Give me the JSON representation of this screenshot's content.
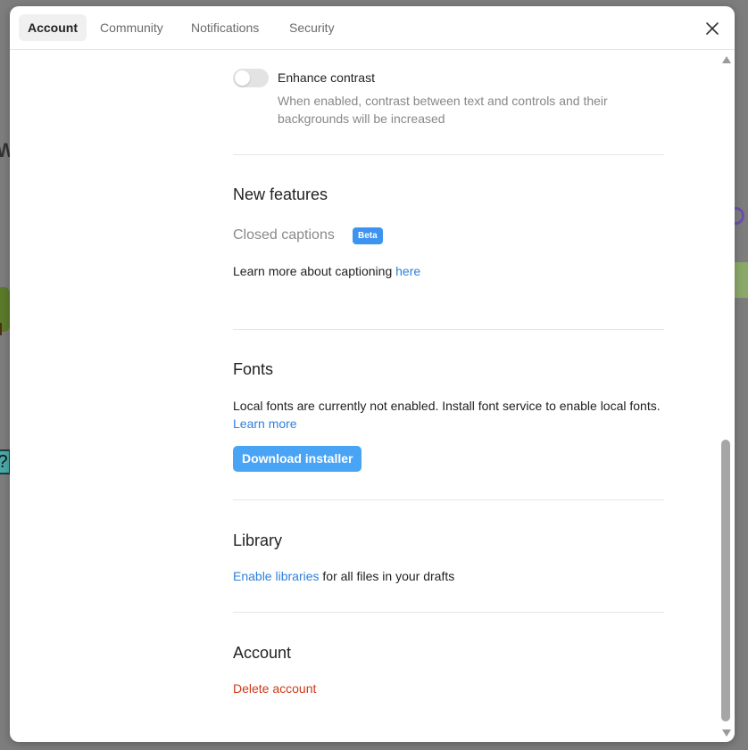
{
  "tabs": [
    {
      "label": "Account",
      "active": true
    },
    {
      "label": "Community",
      "active": false
    },
    {
      "label": "Notifications",
      "active": false
    },
    {
      "label": "Security",
      "active": false
    }
  ],
  "close_icon": "close-icon",
  "accessibility": {
    "toggle_label": "Enhance contrast",
    "toggle_on": false,
    "toggle_desc": "When enabled, contrast between text and controls and their backgrounds will be increased"
  },
  "new_features": {
    "title": "New features",
    "feature_label": "Closed captions",
    "badge": "Beta",
    "learn_prefix": "Learn more about captioning ",
    "learn_link": "here"
  },
  "fonts": {
    "title": "Fonts",
    "text": "Local fonts are currently not enabled. Install font service to enable local fonts. ",
    "learn_link": "Learn more",
    "download_button": "Download installer"
  },
  "library": {
    "title": "Library",
    "link": "Enable libraries",
    "suffix": " for all files in your drafts"
  },
  "account": {
    "title": "Account",
    "delete": "Delete account"
  },
  "colors": {
    "accent": "#2f80d9",
    "button": "#4aa4f5",
    "danger": "#cc3a1a",
    "badge": "#3d93f0"
  }
}
